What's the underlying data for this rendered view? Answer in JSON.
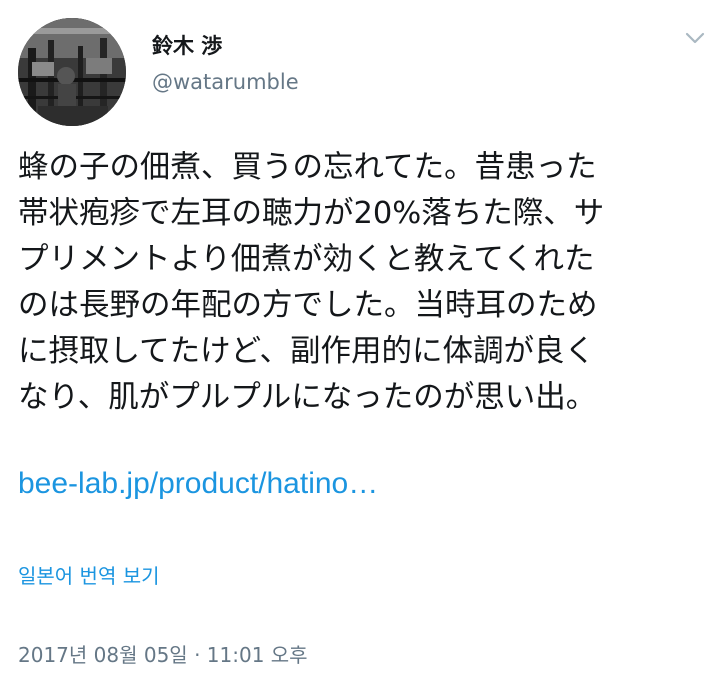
{
  "author": {
    "display_name": "鈴木 渉",
    "handle": "@watarumble",
    "avatar_icon": "profile-photo"
  },
  "menu": {
    "icon": "chevron-down-icon"
  },
  "tweet": {
    "lines": [
      "蜂の子の佃煮、買うの忘れてた。昔患った",
      "帯状疱疹で左耳の聴力が20%落ちた際、サ",
      "プリメントより佃煮が効くと教えてくれた",
      "のは長野の年配の方でした。当時耳のため",
      "に摂取してたけど、副作用的に体調が良く",
      "なり、肌がプルプルになったのが思い出。"
    ],
    "link": "bee-lab.jp/product/hatino…",
    "translate_label": "일본어 번역 보기",
    "timestamp": "2017년 08월 05일 · 11:01 오후"
  },
  "colors": {
    "link": "#1b95e0",
    "secondary_text": "#657786",
    "primary_text": "#14171a"
  }
}
